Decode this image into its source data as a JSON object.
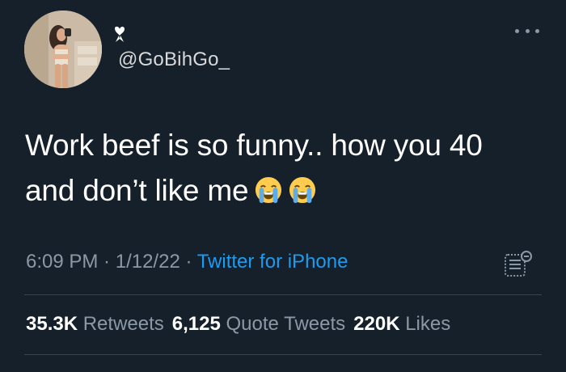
{
  "author": {
    "handle": "@GoBihGo_",
    "display_name_icon": "heart-ribbon-icon",
    "avatar": "profile-photo"
  },
  "tweet": {
    "text_line1": "Work beef is so funny.. how you 40",
    "text_line2": "and don’t like me",
    "emojis": [
      "loudly-crying-face-emoji",
      "loudly-crying-face-emoji"
    ]
  },
  "meta": {
    "time": "6:09 PM",
    "separator1": " · ",
    "date": "1/12/22",
    "separator2": " · ",
    "source": "Twitter for iPhone"
  },
  "stats": {
    "retweets_count": "35.3K",
    "retweets_label": "Retweets",
    "quotes_count": "6,125",
    "quotes_label": "Quote Tweets",
    "likes_count": "220K",
    "likes_label": "Likes"
  },
  "colors": {
    "background": "#15202b",
    "text": "#ffffff",
    "muted": "#8b98a5",
    "link": "#1d9bf0",
    "divider": "#38444d"
  }
}
